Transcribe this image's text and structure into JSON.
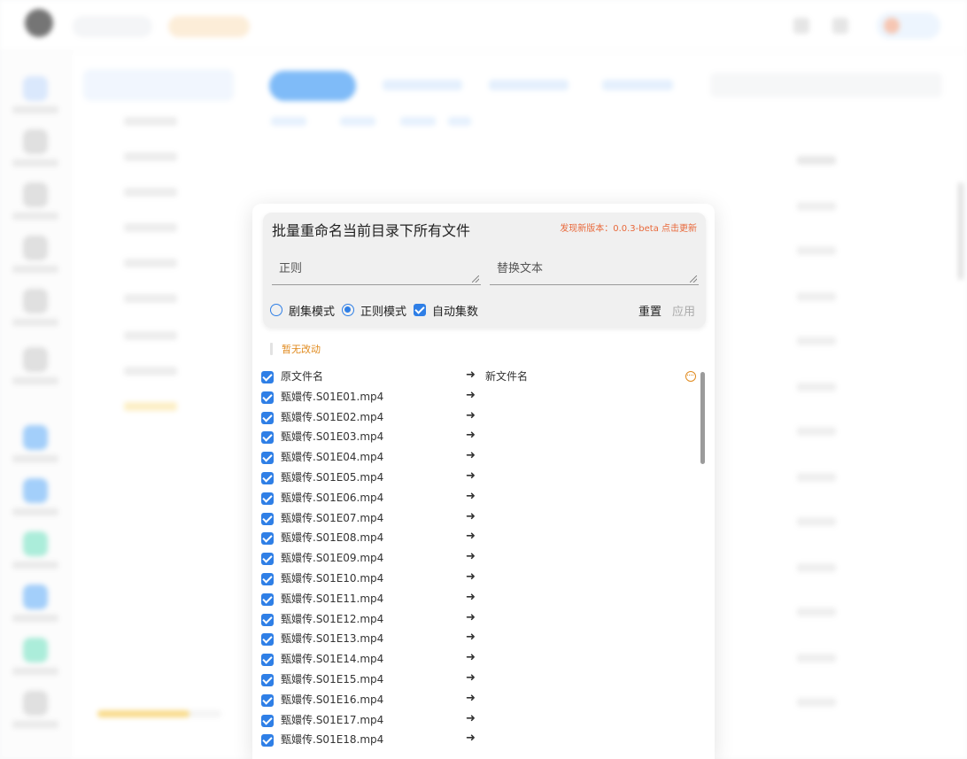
{
  "dialog": {
    "title": "批量重命名当前目录下所有文件",
    "update_notice": "发现新版本：0.0.3-beta 点击更新",
    "regex_placeholder": "正则",
    "replace_placeholder": "替换文本",
    "mode_episode_label": "剧集模式",
    "mode_regex_label": "正则模式",
    "auto_episode_label": "自动集数",
    "reset_label": "重置",
    "apply_label": "应用",
    "status": "暂无改动",
    "column_original": "原文件名",
    "column_new": "新文件名",
    "arrow": "➜",
    "colors": {
      "accent": "#2f7fe6",
      "warning": "#e08a1e",
      "update": "#e8683a"
    }
  },
  "files": [
    {
      "original": "甄嬛传.S01E01.mp4",
      "new": ""
    },
    {
      "original": "甄嬛传.S01E02.mp4",
      "new": ""
    },
    {
      "original": "甄嬛传.S01E03.mp4",
      "new": ""
    },
    {
      "original": "甄嬛传.S01E04.mp4",
      "new": ""
    },
    {
      "original": "甄嬛传.S01E05.mp4",
      "new": ""
    },
    {
      "original": "甄嬛传.S01E06.mp4",
      "new": ""
    },
    {
      "original": "甄嬛传.S01E07.mp4",
      "new": ""
    },
    {
      "original": "甄嬛传.S01E08.mp4",
      "new": ""
    },
    {
      "original": "甄嬛传.S01E09.mp4",
      "new": ""
    },
    {
      "original": "甄嬛传.S01E10.mp4",
      "new": ""
    },
    {
      "original": "甄嬛传.S01E11.mp4",
      "new": ""
    },
    {
      "original": "甄嬛传.S01E12.mp4",
      "new": ""
    },
    {
      "original": "甄嬛传.S01E13.mp4",
      "new": ""
    },
    {
      "original": "甄嬛传.S01E14.mp4",
      "new": ""
    },
    {
      "original": "甄嬛传.S01E15.mp4",
      "new": ""
    },
    {
      "original": "甄嬛传.S01E16.mp4",
      "new": ""
    },
    {
      "original": "甄嬛传.S01E17.mp4",
      "new": ""
    },
    {
      "original": "甄嬛传.S01E18.mp4",
      "new": ""
    }
  ]
}
